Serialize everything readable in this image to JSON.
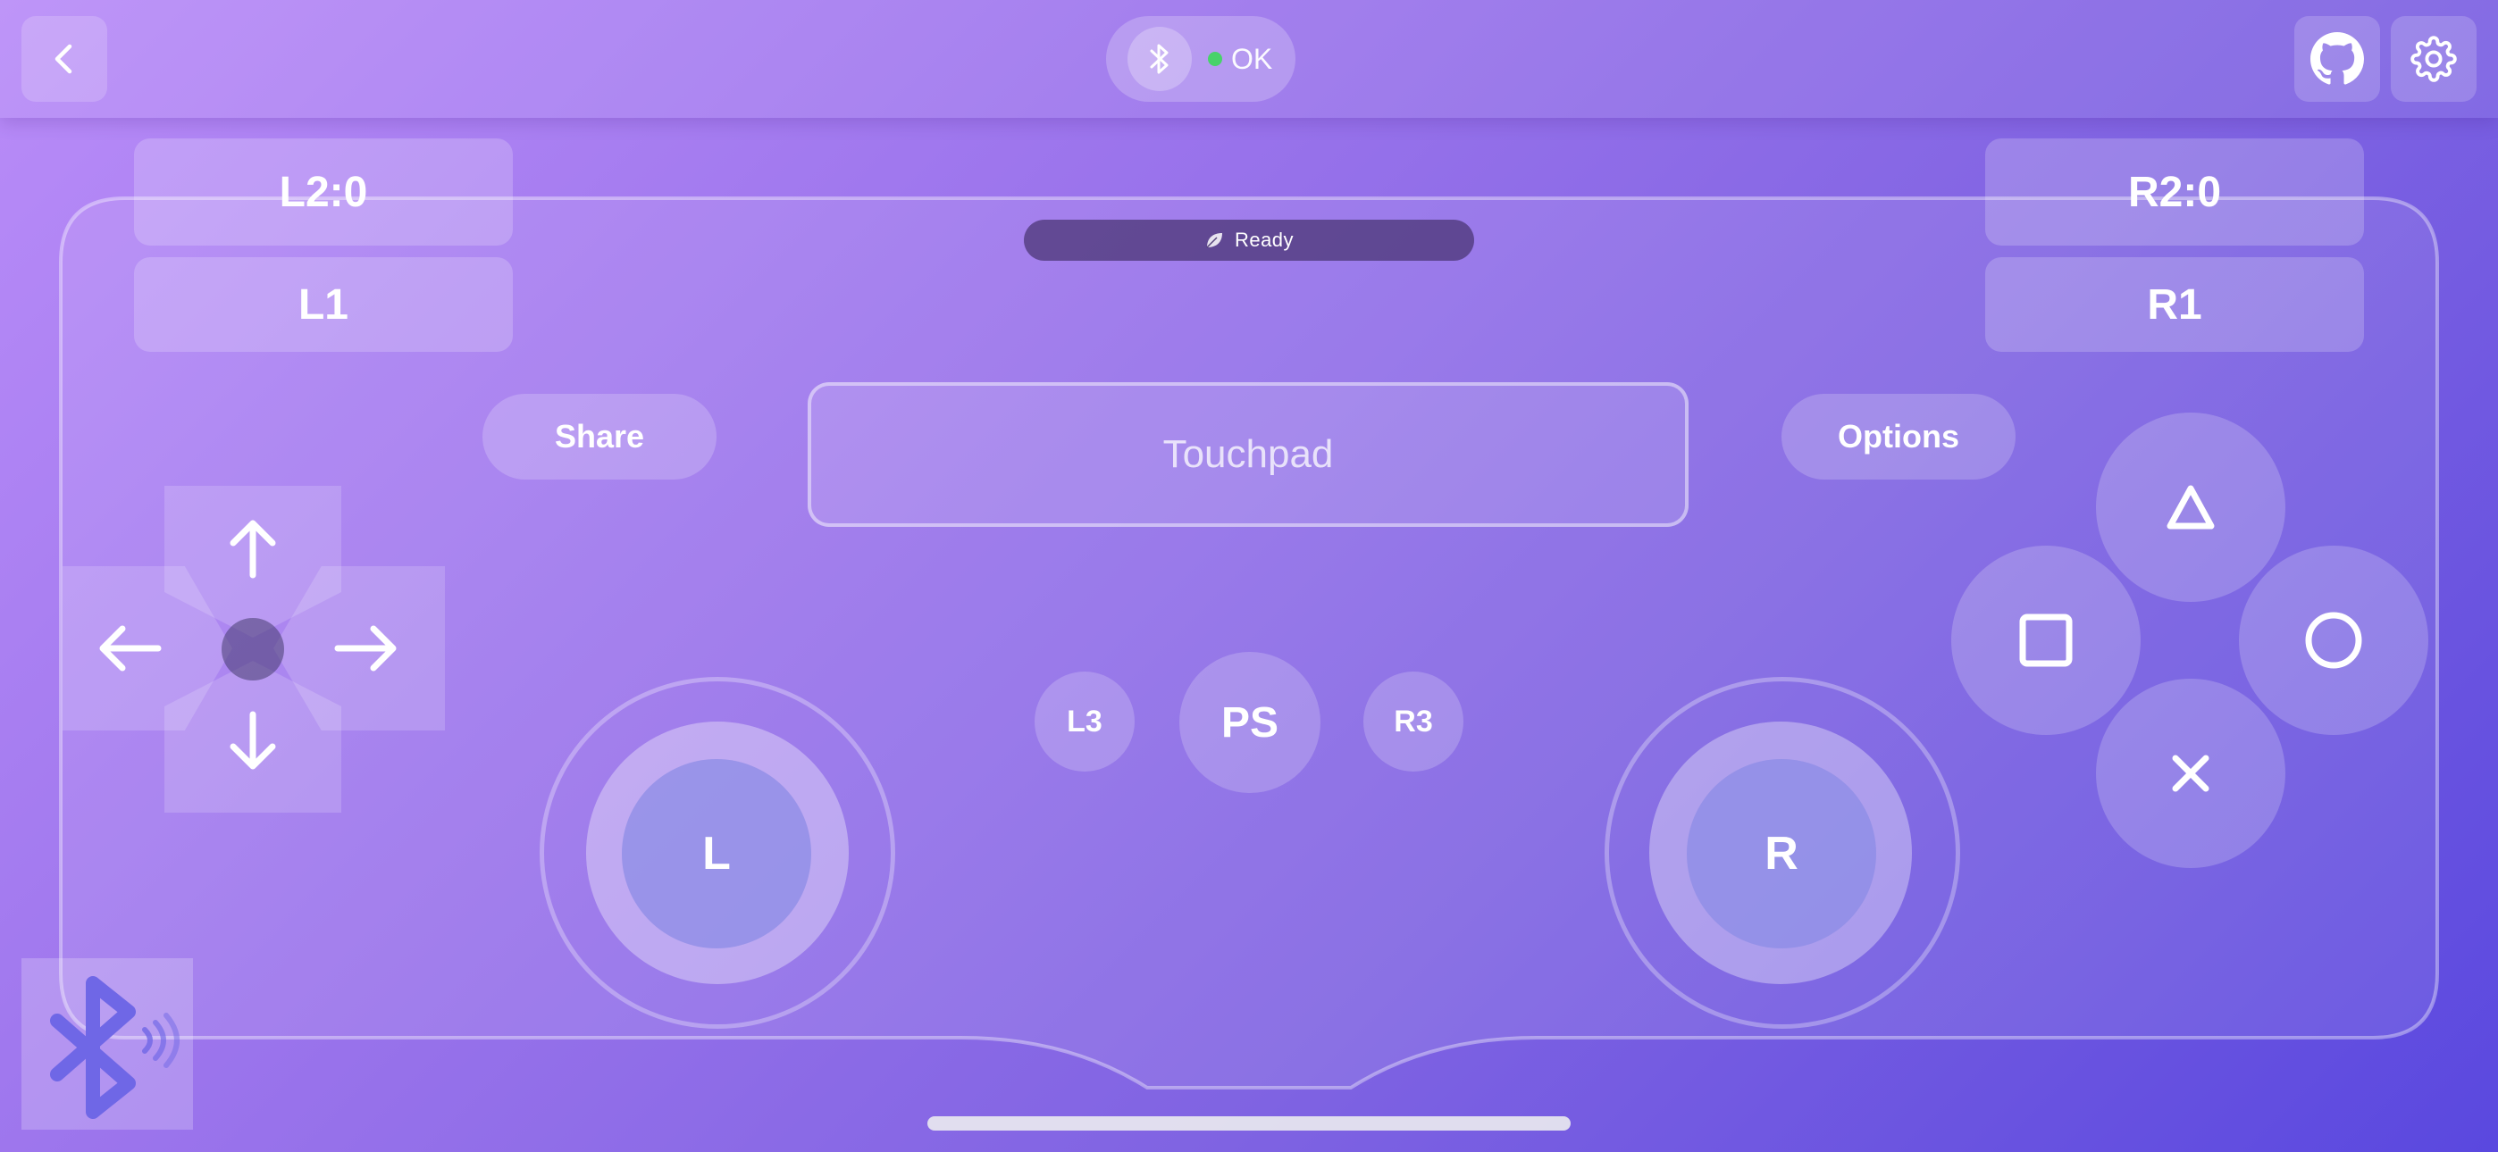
{
  "topbar": {
    "back_icon": "chevron-left-icon",
    "connection_icon": "bluetooth-icon",
    "connection_status": "OK",
    "connection_color": "#48d26a",
    "github_icon": "github-icon",
    "settings_icon": "gear-icon"
  },
  "triggers": {
    "l2": "L2:0",
    "l1": "L1",
    "r2": "R2:0",
    "r1": "R1"
  },
  "ready": {
    "icon": "leaf-icon",
    "label": "Ready"
  },
  "center": {
    "share": "Share",
    "options": "Options",
    "touchpad": "Touchpad",
    "l3": "L3",
    "ps": "PS",
    "r3": "R3"
  },
  "sticks": {
    "left": "L",
    "right": "R"
  },
  "dpad": {
    "up": "arrow-up-icon",
    "down": "arrow-down-icon",
    "left": "arrow-left-icon",
    "right": "arrow-right-icon"
  },
  "face_buttons": {
    "triangle": "triangle-icon",
    "square": "square-icon",
    "circle": "circle-icon",
    "cross": "cross-icon"
  },
  "corner": {
    "icon": "bluetooth-broadcast-icon"
  },
  "colors": {
    "accent": "#8f6ae9",
    "status_ok": "#48d26a"
  }
}
